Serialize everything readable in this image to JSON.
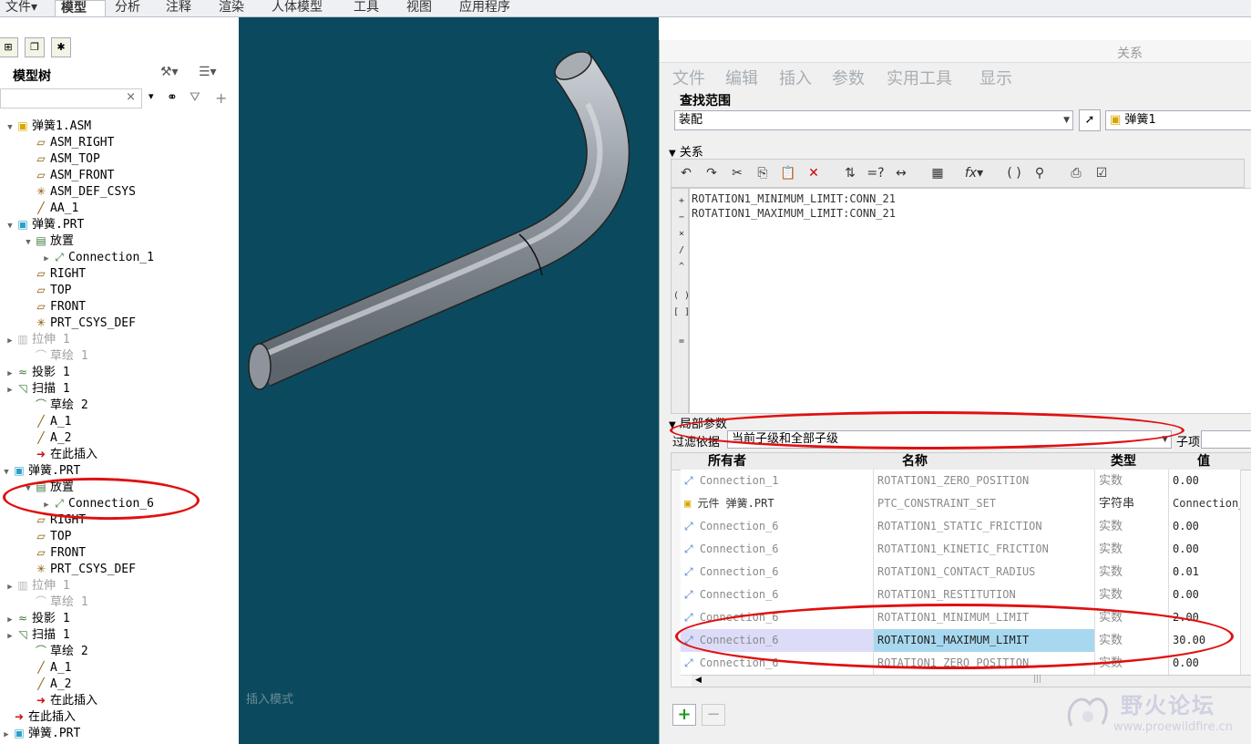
{
  "ribbon": {
    "tabs": [
      "文件▾",
      "模型",
      "分析",
      "注释",
      "渲染",
      "人体模型",
      "工具",
      "视图",
      "应用程序"
    ],
    "active_tab": "模型"
  },
  "model_tree": {
    "title": "模型树",
    "search_placeholder": "",
    "items": [
      {
        "label": "弹簧1.ASM",
        "icon": "assembly-icon",
        "dim": false
      },
      {
        "label": "ASM_RIGHT",
        "icon": "datum-plane-icon",
        "dim": false
      },
      {
        "label": "ASM_TOP",
        "icon": "datum-plane-icon",
        "dim": false
      },
      {
        "label": "ASM_FRONT",
        "icon": "datum-plane-icon",
        "dim": false
      },
      {
        "label": "ASM_DEF_CSYS",
        "icon": "csys-icon",
        "dim": false
      },
      {
        "label": "AA_1",
        "icon": "datum-axis-icon",
        "dim": false
      },
      {
        "label": "弹簧.PRT",
        "icon": "part-icon",
        "dim": false
      },
      {
        "label": "放置",
        "icon": "placement-icon",
        "dim": false
      },
      {
        "label": "Connection_1",
        "icon": "connection-icon",
        "dim": false
      },
      {
        "label": "RIGHT",
        "icon": "datum-plane-icon",
        "dim": false
      },
      {
        "label": "TOP",
        "icon": "datum-plane-icon",
        "dim": false
      },
      {
        "label": "FRONT",
        "icon": "datum-plane-icon",
        "dim": false
      },
      {
        "label": "PRT_CSYS_DEF",
        "icon": "csys-icon",
        "dim": false
      },
      {
        "label": "拉伸 1",
        "icon": "extrude-icon",
        "dim": true
      },
      {
        "label": "草绘 1",
        "icon": "sketch-icon",
        "dim": true
      },
      {
        "label": "投影 1",
        "icon": "projection-icon",
        "dim": false
      },
      {
        "label": "扫描 1",
        "icon": "sweep-icon",
        "dim": false
      },
      {
        "label": "草绘 2",
        "icon": "sketch-icon",
        "dim": false
      },
      {
        "label": "A_1",
        "icon": "datum-axis-icon",
        "dim": false
      },
      {
        "label": "A_2",
        "icon": "datum-axis-icon",
        "dim": false
      },
      {
        "label": "在此插入",
        "icon": "insert-here-icon",
        "dim": false
      },
      {
        "label": "弹簧.PRT",
        "icon": "part-icon",
        "dim": false
      },
      {
        "label": "放置",
        "icon": "placement-icon",
        "dim": false
      },
      {
        "label": "Connection_6",
        "icon": "connection-icon",
        "dim": false
      },
      {
        "label": "RIGHT",
        "icon": "datum-plane-icon",
        "dim": false
      },
      {
        "label": "TOP",
        "icon": "datum-plane-icon",
        "dim": false
      },
      {
        "label": "FRONT",
        "icon": "datum-plane-icon",
        "dim": false
      },
      {
        "label": "PRT_CSYS_DEF",
        "icon": "csys-icon",
        "dim": false
      },
      {
        "label": "拉伸 1",
        "icon": "extrude-icon",
        "dim": true
      },
      {
        "label": "草绘 1",
        "icon": "sketch-icon",
        "dim": true
      },
      {
        "label": "投影 1",
        "icon": "projection-icon",
        "dim": false
      },
      {
        "label": "扫描 1",
        "icon": "sweep-icon",
        "dim": false
      },
      {
        "label": "草绘 2",
        "icon": "sketch-icon",
        "dim": false
      },
      {
        "label": "A_1",
        "icon": "datum-axis-icon",
        "dim": false
      },
      {
        "label": "A_2",
        "icon": "datum-axis-icon",
        "dim": false
      },
      {
        "label": "在此插入",
        "icon": "insert-here-icon",
        "dim": false
      },
      {
        "label": "在此插入",
        "icon": "insert-here-icon",
        "dim": false
      },
      {
        "label": "弹簧.PRT",
        "icon": "part-icon",
        "dim": false
      }
    ]
  },
  "viewport": {
    "status_text": "插入模式",
    "background_color": "#0b4a5e"
  },
  "relations_dialog": {
    "title": "关系",
    "menu": [
      "文件",
      "编辑",
      "插入",
      "参数",
      "实用工具",
      "显示"
    ],
    "lookup_section": "查找范围",
    "lookup_value": "装配",
    "lookup_model": "弹簧1",
    "relations_section": "关系",
    "relations": [
      "ROTATION1_MINIMUM_LIMIT:CONN_21",
      "ROTATION1_MAXIMUM_LIMIT:CONN_21"
    ],
    "side_ops": [
      "+",
      "−",
      "×",
      "/",
      "^",
      "( )",
      "[ ]",
      "="
    ],
    "local_params_section": "局部参数",
    "filter_label": "过滤依据",
    "filter_value": "当前子级和全部子级",
    "subitem_label": "子项",
    "columns": [
      "所有者",
      "名称",
      "类型",
      "值"
    ],
    "rows": [
      {
        "owner": "Connection_1",
        "name": "ROTATION1_ZERO_POSITION",
        "type": "实数",
        "value": "0.00"
      },
      {
        "owner": "元件 弹簧.PRT",
        "name": "PTC_CONSTRAINT_SET",
        "type": "字符串",
        "value": "Connection_"
      },
      {
        "owner": "Connection_6",
        "name": "ROTATION1_STATIC_FRICTION",
        "type": "实数",
        "value": "0.00"
      },
      {
        "owner": "Connection_6",
        "name": "ROTATION1_KINETIC_FRICTION",
        "type": "实数",
        "value": "0.00"
      },
      {
        "owner": "Connection_6",
        "name": "ROTATION1_CONTACT_RADIUS",
        "type": "实数",
        "value": "0.01"
      },
      {
        "owner": "Connection_6",
        "name": "ROTATION1_RESTITUTION",
        "type": "实数",
        "value": "0.00"
      },
      {
        "owner": "Connection_6",
        "name": "ROTATION1_MINIMUM_LIMIT",
        "type": "实数",
        "value": "2.00"
      },
      {
        "owner": "Connection_6",
        "name": "ROTATION1_MAXIMUM_LIMIT",
        "type": "实数",
        "value": "30.00"
      },
      {
        "owner": "Connection_6",
        "name": "ROTATION1_ZERO_POSITION",
        "type": "实数",
        "value": "0.00"
      }
    ],
    "add_label": "+",
    "remove_label": "−"
  },
  "watermark": {
    "name": "野火论坛",
    "url": "www.proewildfire.cn"
  },
  "colors": {
    "annotation_red": "#e01010",
    "selected_cell": "#a8d8f0",
    "selected_owner": "#dcdcf8"
  }
}
